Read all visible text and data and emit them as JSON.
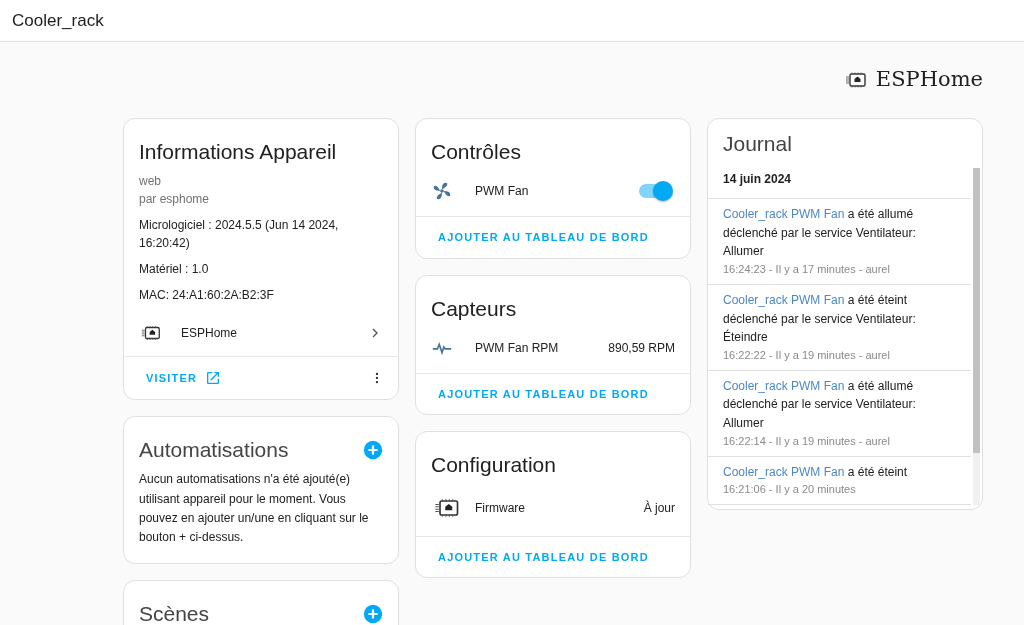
{
  "header": {
    "title": "Cooler_rack"
  },
  "brand": {
    "name": "ESPHome"
  },
  "device_info": {
    "title": "Informations Appareil",
    "model": "web",
    "manufacturer": "par esphome",
    "firmware": "Micrologiciel : 2024.5.5 (Jun 14 2024, 16:20:42)",
    "hardware": "Matériel : 1.0",
    "mac": "MAC: 24:A1:60:2A:B2:3F",
    "integration": "ESPHome",
    "visit_link": "VISITER"
  },
  "automations": {
    "title": "Automatisations",
    "text": "Aucun automatisations n'a été ajouté(e) utilisant appareil pour le moment. Vous pouvez en ajouter un/une en cliquant sur le bouton + ci-dessus."
  },
  "scenes": {
    "title": "Scènes"
  },
  "entity_cards": [
    {
      "title": "Contrôles",
      "entities": [
        {
          "kind": "switch",
          "name": "PWM Fan",
          "on": true
        }
      ],
      "action": "AJOUTER AU TABLEAU DE BORD"
    },
    {
      "title": "Capteurs",
      "entities": [
        {
          "kind": "sensor",
          "name": "PWM Fan RPM",
          "state": "890,59 RPM"
        }
      ],
      "action": "AJOUTER AU TABLEAU DE BORD"
    },
    {
      "title": "Configuration",
      "entities": [
        {
          "kind": "update",
          "name": "Firmware",
          "state": "À jour"
        }
      ],
      "action": "AJOUTER AU TABLEAU DE BORD"
    }
  ],
  "logbook": {
    "title": "Journal",
    "date": "14 juin 2024",
    "entries": [
      {
        "entity": "Cooler_rack PWM Fan",
        "message": "a été allumé déclenché par le service Ventilateur: Allumer",
        "meta": "16:24:23 - Il y a 17 minutes - aurel"
      },
      {
        "entity": "Cooler_rack PWM Fan",
        "message": "a été éteint déclenché par le service Ventilateur: Éteindre",
        "meta": "16:22:22 - Il y a 19 minutes - aurel"
      },
      {
        "entity": "Cooler_rack PWM Fan",
        "message": "a été allumé déclenché par le service Ventilateur: Allumer",
        "meta": "16:22:14 - Il y a 19 minutes - aurel"
      },
      {
        "entity": "Cooler_rack PWM Fan",
        "message": "a été éteint",
        "meta": "16:21:06 - Il y a 20 minutes"
      }
    ]
  }
}
